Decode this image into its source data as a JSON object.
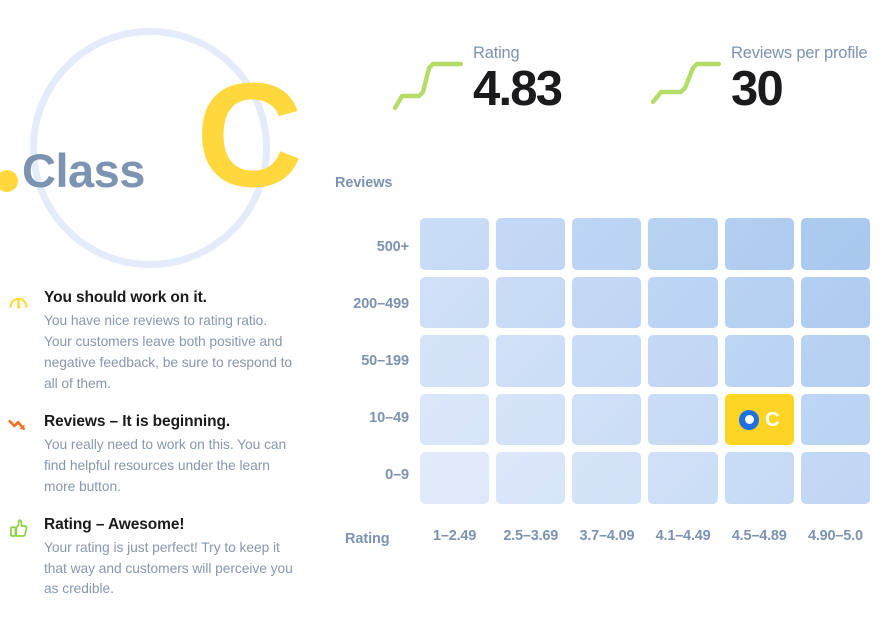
{
  "brand": {
    "word": "Class",
    "grade": "C",
    "dot_color": "#ffd83d",
    "word_color": "#7d93b2",
    "grade_color": "#ffd83d",
    "circle_color": "#e4ecfb"
  },
  "advisories": [
    {
      "icon": "gauge-icon",
      "icon_color": "#ffd83d",
      "title": "You should work on it.",
      "body": "You have nice reviews to rating ratio. Your customers leave both positive and negative feedback, be sure to respond to all of them."
    },
    {
      "icon": "trend-down-icon",
      "icon_color": "#f4722b",
      "title": "Reviews – It is beginning.",
      "body": "You really need to work on this. You can find helpful resources under the learn more button."
    },
    {
      "icon": "thumbs-up-icon",
      "icon_color": "#8ed04a",
      "title": "Rating – Awesome!",
      "body": "Your rating is just perfect! Try to keep it that way and customers will perceive you as credible."
    }
  ],
  "kpis": [
    {
      "label": "Rating",
      "value": "4.83",
      "spark": "step-up-sparkline",
      "spark_color": "#b5dc68"
    },
    {
      "label": "Reviews per profile",
      "value": "30",
      "spark": "step-up-sparkline",
      "spark_color": "#b5dc68"
    }
  ],
  "chart_data": {
    "type": "heatmap",
    "title": "",
    "xlabel": "Rating",
    "ylabel": "Reviews",
    "categories_x": [
      "1–2.49",
      "2.5–3.69",
      "3.7–4.09",
      "4.1–4.49",
      "4.5–4.89",
      "4.90–5.0"
    ],
    "categories_y": [
      "500+",
      "200–499",
      "50–199",
      "10–49",
      "0–9"
    ],
    "grid": true,
    "legend": "none",
    "highlight": {
      "row_label": "10–49",
      "col_label": "4.5–4.89",
      "row_index": 3,
      "col_index": 4,
      "grade": "C",
      "cell_color": "#ffd525",
      "marker_color": "#1f6fe5",
      "marker_inner_color": "#ffffff",
      "grade_color": "#ffffff"
    },
    "cell_color_min": "#e3ecfb",
    "cell_color_max": "#a8c8ef",
    "values": [
      [
        0.5,
        0.6,
        0.7,
        0.8,
        0.9,
        1.0
      ],
      [
        0.4,
        0.5,
        0.6,
        0.7,
        0.8,
        0.9
      ],
      [
        0.3,
        0.4,
        0.5,
        0.6,
        0.7,
        0.8
      ],
      [
        0.2,
        0.3,
        0.4,
        0.5,
        0.6,
        0.7
      ],
      [
        0.1,
        0.2,
        0.3,
        0.4,
        0.5,
        0.6
      ]
    ]
  }
}
